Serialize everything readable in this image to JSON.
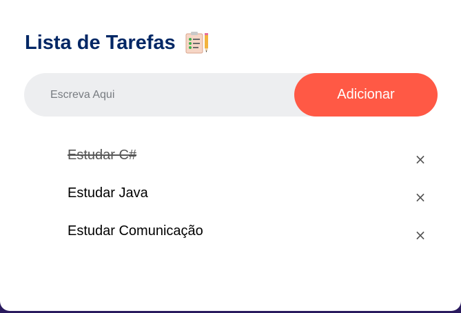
{
  "app": {
    "title": "Lista de Tarefas",
    "title_icon": "clipboard-checklist-icon"
  },
  "input": {
    "value": "",
    "placeholder": "Escreva Aqui"
  },
  "add_button": {
    "label": "Adicionar"
  },
  "tasks": [
    {
      "text": "Estudar C#",
      "checked": true,
      "delete_icon": "×"
    },
    {
      "text": "Estudar Java",
      "checked": false,
      "delete_icon": "×"
    },
    {
      "text": "Estudar Comunicação",
      "checked": false,
      "delete_icon": "×"
    }
  ],
  "colors": {
    "title": "#002765",
    "accent": "#ff5945",
    "input_bg": "#edeef0",
    "page_bg": "#2a1a5e"
  }
}
